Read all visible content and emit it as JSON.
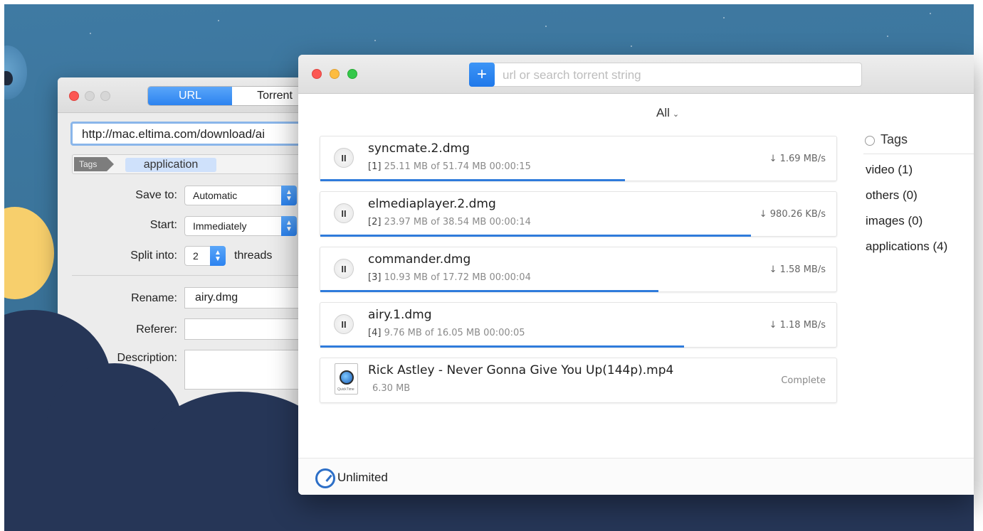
{
  "add_window": {
    "tabs": [
      {
        "label": "URL",
        "active": true
      },
      {
        "label": "Torrent",
        "active": false
      }
    ],
    "url_value": "http://mac.eltima.com/download/ai",
    "tags_label": "Tags",
    "tag_chip": "application",
    "save_to_label": "Save to:",
    "save_to_value": "Automatic",
    "start_label": "Start:",
    "start_value": "Immediately",
    "split_label": "Split into:",
    "split_value": "2",
    "split_suffix": "threads",
    "rename_label": "Rename:",
    "rename_value": "airy.dmg",
    "referer_label": "Referer:",
    "referer_value": "",
    "description_label": "Description:",
    "description_value": ""
  },
  "main_window": {
    "search_placeholder": "url or search torrent string",
    "add_button_label": "+",
    "filter_label": "All",
    "downloads": [
      {
        "name": "syncmate.2.dmg",
        "index": "[1]",
        "meta": "25.11 MB of 51.74 MB  00:00:15",
        "speed": "↓ 1.69 MB/s",
        "progress": 0.59,
        "state": "downloading"
      },
      {
        "name": "elmediaplayer.2.dmg",
        "index": "[2]",
        "meta": "23.97 MB of 38.54 MB  00:00:14",
        "speed": "↓ 980.26 KB/s",
        "progress": 0.835,
        "state": "downloading"
      },
      {
        "name": "commander.dmg",
        "index": "[3]",
        "meta": "10.93 MB of 17.72 MB  00:00:04",
        "speed": "↓ 1.58 MB/s",
        "progress": 0.655,
        "state": "downloading"
      },
      {
        "name": "airy.1.dmg",
        "index": "[4]",
        "meta": "9.76 MB of 16.05 MB  00:00:05",
        "speed": "↓ 1.18 MB/s",
        "progress": 0.705,
        "state": "downloading"
      },
      {
        "name": "Rick Astley - Never Gonna Give You Up(144p).mp4",
        "index": "",
        "meta": "6.30 MB",
        "speed": "Complete",
        "progress": 1.0,
        "state": "complete"
      }
    ],
    "tags_panel": {
      "title": "Tags",
      "items": [
        "video (1)",
        "others (0)",
        "images (0)",
        "applications (4)"
      ]
    },
    "status": {
      "speed_limit": "Unlimited"
    }
  },
  "icons": {
    "pause": "pause-icon",
    "file": "quicktime-file-icon",
    "gauge": "speedometer-icon"
  },
  "colors": {
    "accent": "#2f7bdb",
    "night": "#263657",
    "cloud_warm": "#f7cf6c"
  }
}
